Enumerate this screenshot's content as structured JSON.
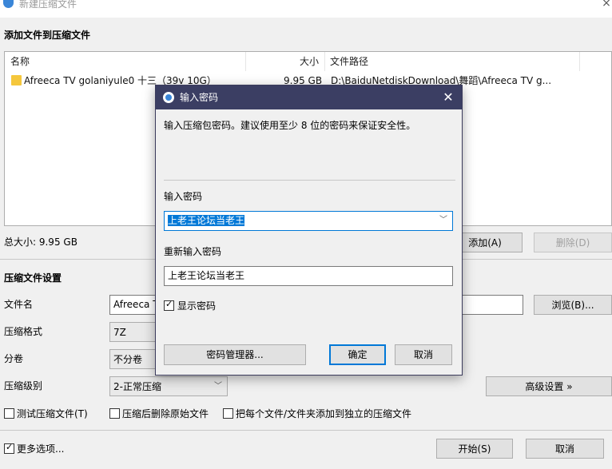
{
  "window": {
    "title": "新建压缩文件",
    "app_icon": "winrar-icon",
    "close_glyph": "×"
  },
  "add_section": {
    "title": "添加文件到压缩文件",
    "columns": {
      "name": "名称",
      "size": "大小",
      "path": "文件路径"
    },
    "rows": [
      {
        "name": "Afreeca TV golaniyule0 十三（39v 10G）",
        "size": "9.95 GB",
        "path": "D:\\BaiduNetdiskDownload\\舞蹈\\Afreeca TV g..."
      }
    ],
    "total_size": "总大小: 9.95 GB",
    "add_button": "添加(A)",
    "delete_button": "删除(D)"
  },
  "settings": {
    "title": "压缩文件设置",
    "filename_label": "文件名",
    "filename_value": "Afreeca T",
    "browse_button": "浏览(B)...",
    "format_label": "压缩格式",
    "format_value": "7Z",
    "volume_label": "分卷",
    "volume_value": "不分卷",
    "level_label": "压缩级别",
    "level_value": "2-正常压缩",
    "advanced_button": "高级设置 »",
    "options": [
      {
        "label": "测试压缩文件(T)",
        "checked": false
      },
      {
        "label": "压缩后删除原始文件",
        "checked": false
      },
      {
        "label": "把每个文件/文件夹添加到独立的压缩文件",
        "checked": false
      }
    ]
  },
  "footer": {
    "more_options": "更多选项...",
    "more_checked": true,
    "start_button": "开始(S)",
    "cancel_button": "取消"
  },
  "password_dialog": {
    "title": "输入密码",
    "close_glyph": "✕",
    "description": "输入压缩包密码。建议使用至少 8 位的密码来保证安全性。",
    "password_label": "输入密码",
    "password_value": "上老王论坛当老王",
    "confirm_label": "重新输入密码",
    "confirm_value": "上老王论坛当老王",
    "show_password_label": "显示密码",
    "show_password_checked": true,
    "manager_button": "密码管理器...",
    "ok_button": "确定",
    "cancel_button": "取消"
  },
  "colors": {
    "dialog_title_bg": "#3b3e63",
    "selection": "#0078d7",
    "accent": "#3a86d8"
  }
}
